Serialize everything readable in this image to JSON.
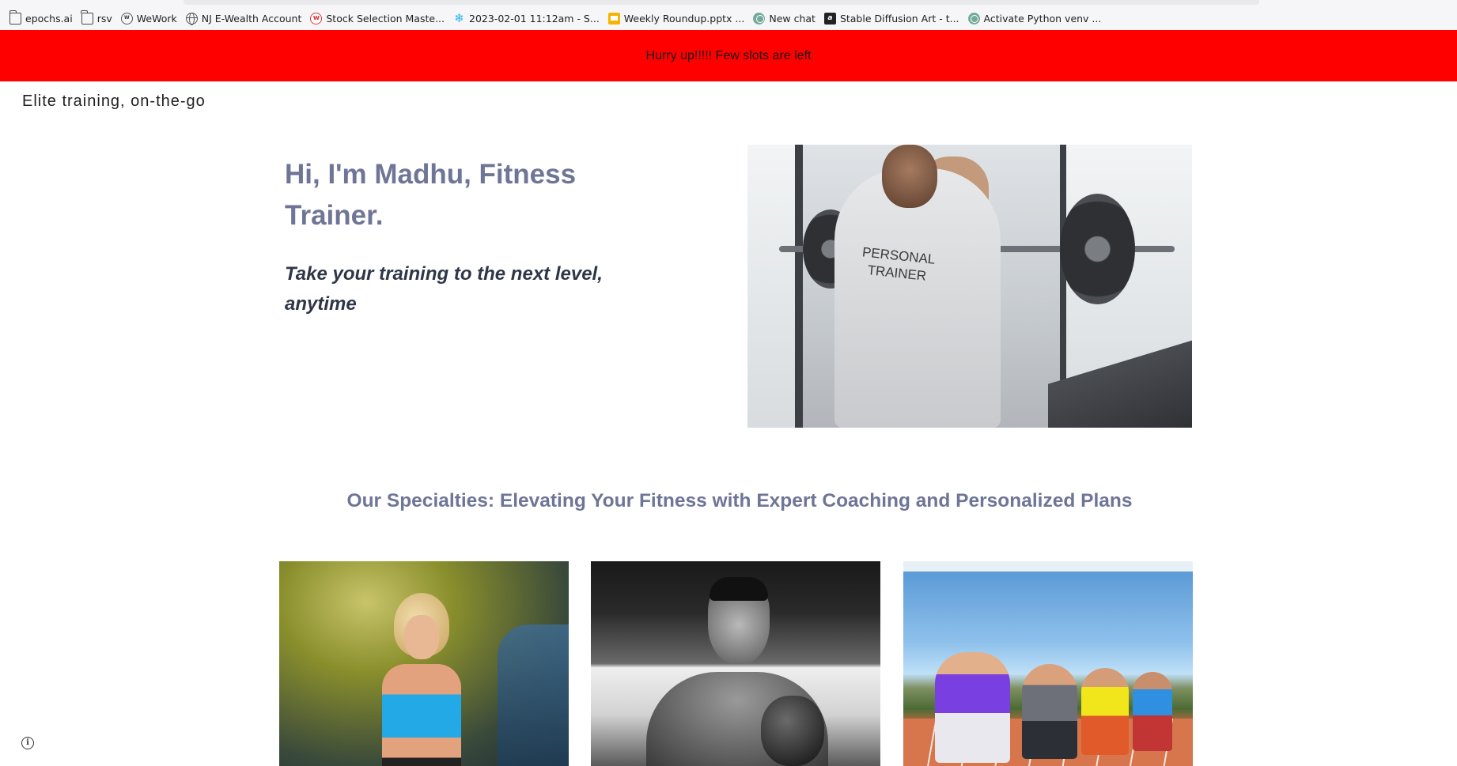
{
  "bookmarks": [
    {
      "icon": "folder-icon",
      "label": "epochs.ai"
    },
    {
      "icon": "folder-icon",
      "label": "rsv"
    },
    {
      "icon": "wework-icon",
      "label": "WeWork"
    },
    {
      "icon": "globe-icon",
      "label": "NJ E-Wealth Account"
    },
    {
      "icon": "stock-selection-icon",
      "label": "Stock Selection Maste..."
    },
    {
      "icon": "snowflake-icon",
      "label": "2023-02-01 11:12am - S..."
    },
    {
      "icon": "slides-icon",
      "label": "Weekly Roundup.pptx ..."
    },
    {
      "icon": "chatgpt-icon",
      "label": "New chat"
    },
    {
      "icon": "stable-diffusion-icon",
      "label": "Stable Diffusion Art - t..."
    },
    {
      "icon": "chatgpt-icon",
      "label": "Activate Python venv ..."
    }
  ],
  "banner": {
    "text": "Hurry up!!!!! Few slots are left",
    "color": "#ff0000"
  },
  "site": {
    "title": "Elite training, on-the-go"
  },
  "hero": {
    "heading": "Hi, I'm Madhu, Fitness Trainer.",
    "subheading": "Take your training to the next level, anytime",
    "image_shirt_text": "PERSONAL TRAINER"
  },
  "specialties": {
    "title": "Our Specialties: Elevating Your Fitness with Expert Coaching and Personalized Plans"
  },
  "colors": {
    "heading": "#6f7596",
    "subheading": "#2e3648",
    "banner": "#ff0000"
  }
}
